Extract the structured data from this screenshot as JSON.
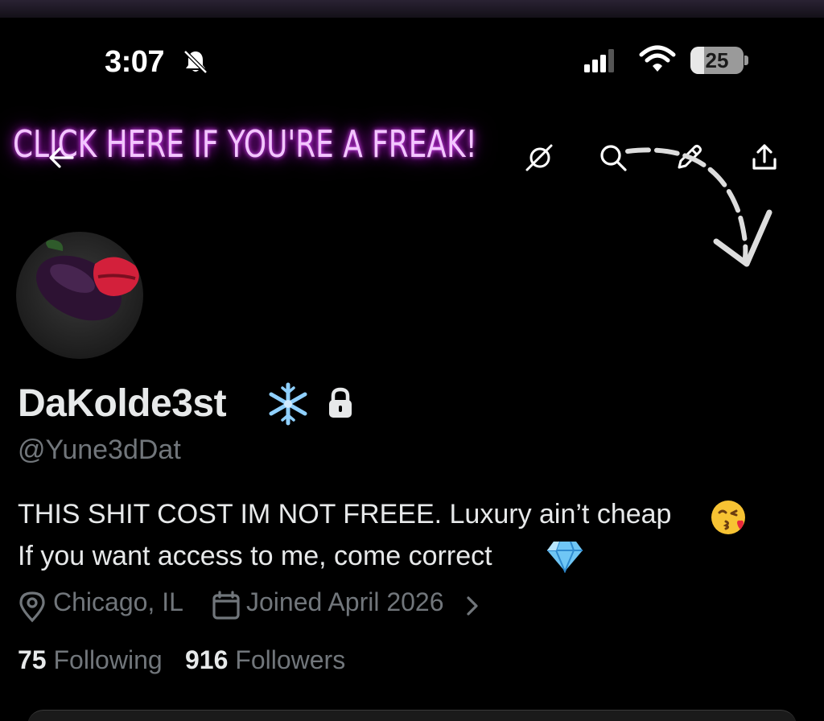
{
  "status_bar": {
    "time": "3:07",
    "battery_level": "25",
    "battery_fraction": 0.25,
    "icons": [
      "bell-slash-icon",
      "cellular-signal-icon",
      "wifi-icon",
      "battery-icon"
    ]
  },
  "banner": {
    "text": "CLICK HERE IF YOU'RE A FREAK!",
    "glow_color": "#e24bff"
  },
  "header": {
    "icons": [
      "back-arrow-icon",
      "grok-icon",
      "search-icon",
      "edit-pencil-icon",
      "share-icon"
    ]
  },
  "profile": {
    "display_name": "DaKolde3st",
    "badges": [
      "snowflake-icon",
      "lock-icon"
    ],
    "handle": "@Yune3dDat",
    "bio_line1": "THIS SHIT COST IM NOT FREEE. Luxury ain’t cheap",
    "bio_line2": "If you want access to me, come correct",
    "location": "Chicago, IL",
    "joined": "Joined April 2026",
    "following_count": "75",
    "following_label": "Following",
    "followers_count": "916",
    "followers_label": "Followers"
  },
  "colors": {
    "background": "#000000",
    "primary_text": "#e7e9ea",
    "secondary_text": "#71767b"
  }
}
